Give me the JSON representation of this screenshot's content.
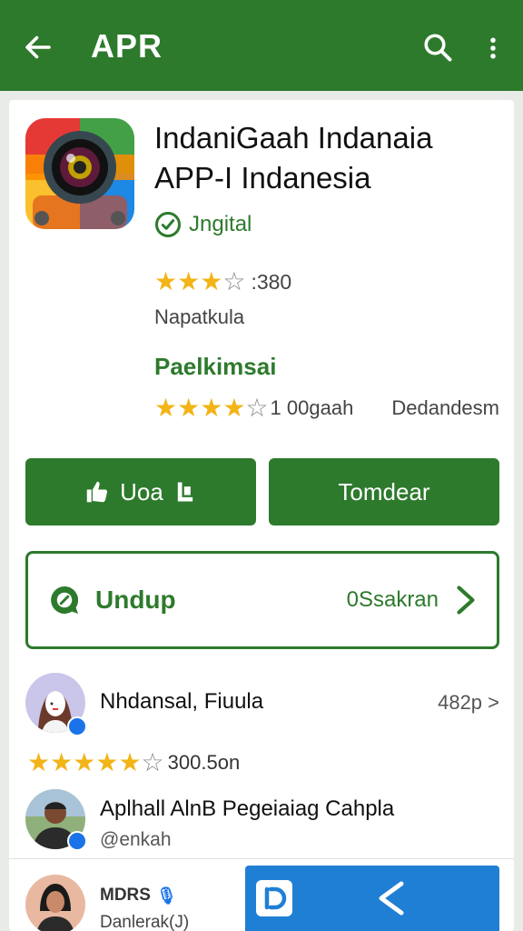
{
  "header": {
    "title": "APR",
    "back_icon": "arrow-left-icon",
    "search_icon": "search-icon",
    "more_icon": "more-vertical-icon",
    "color": "#2d7a2c"
  },
  "app": {
    "name_line1": "IndaniGaah Indanaia",
    "name_line2": "APP-I Indanesia",
    "verified_label": "Jngital",
    "rating_stars": 3.5,
    "rating_count": ":380",
    "subtitle": "Napatkula",
    "section_label": "Paelkimsai",
    "section_rating_stars": 4,
    "section_rating_count": "1 00gaah",
    "section_rating_right": "Dedandesm"
  },
  "buttons": {
    "primary_left": "Uoa",
    "primary_right": "Tomdear",
    "outline_label": "Undup",
    "outline_right": "0Ssakran"
  },
  "reviews": [
    {
      "name": "Nhdansal, Fiuula",
      "meta": "482p >",
      "rating_stars": 4.5,
      "rating_count": "300.5on"
    },
    {
      "name": "Aplhall AlnB Pegeiaiag Cahpla",
      "handle": "@enkah"
    },
    {
      "name": "MDRS",
      "handle": "Danlerak(J)"
    }
  ],
  "bottom_actions": {
    "left_icon": "app-logo-icon",
    "right_icon": "share-icon",
    "color": "#1f7fd4"
  }
}
